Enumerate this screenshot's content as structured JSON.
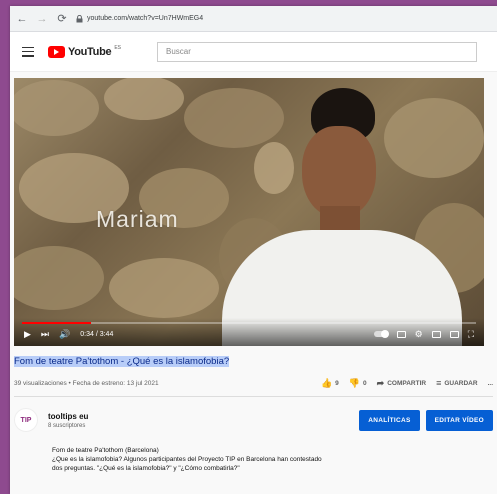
{
  "browser": {
    "url": "youtube.com/watch?v=Un7HWmEG4"
  },
  "header": {
    "logo_text": "YouTube",
    "logo_region": "ES",
    "search_placeholder": "Buscar"
  },
  "video": {
    "overlay_text": "Mariam",
    "time_display": "0:34 / 3:44",
    "progress": 0.152
  },
  "info": {
    "title": "Fom de teatre Pa'tothom - ¿Qué es la islamofobia?",
    "meta": "39 visualizaciones • Fecha de estreno: 13 jul 2021",
    "likes": "9",
    "dislikes": "0",
    "share_label": "COMPARTIR",
    "save_label": "GUARDAR",
    "more_label": "..."
  },
  "channel": {
    "logo_text": "TIP",
    "name": "tooltips eu",
    "subscribers": "8 suscriptores",
    "analytics_label": "ANALÍTICAS",
    "edit_label": "EDITAR VÍDEO"
  },
  "description": {
    "line1": "Fom de teatre Pa'tothom (Barcelona)",
    "line2": "¿Que es la islamofobia? Algunos participantes del Proyecto TIP en Barcelona han contestado",
    "line3": "dos preguntas. \"¿Qué es la islamofobia?\" y \"¿Cómo combatirla?\""
  },
  "colors": {
    "accent": "#065fd4",
    "brand_red": "#ff0000",
    "background_frame": "#8e4a8f"
  }
}
